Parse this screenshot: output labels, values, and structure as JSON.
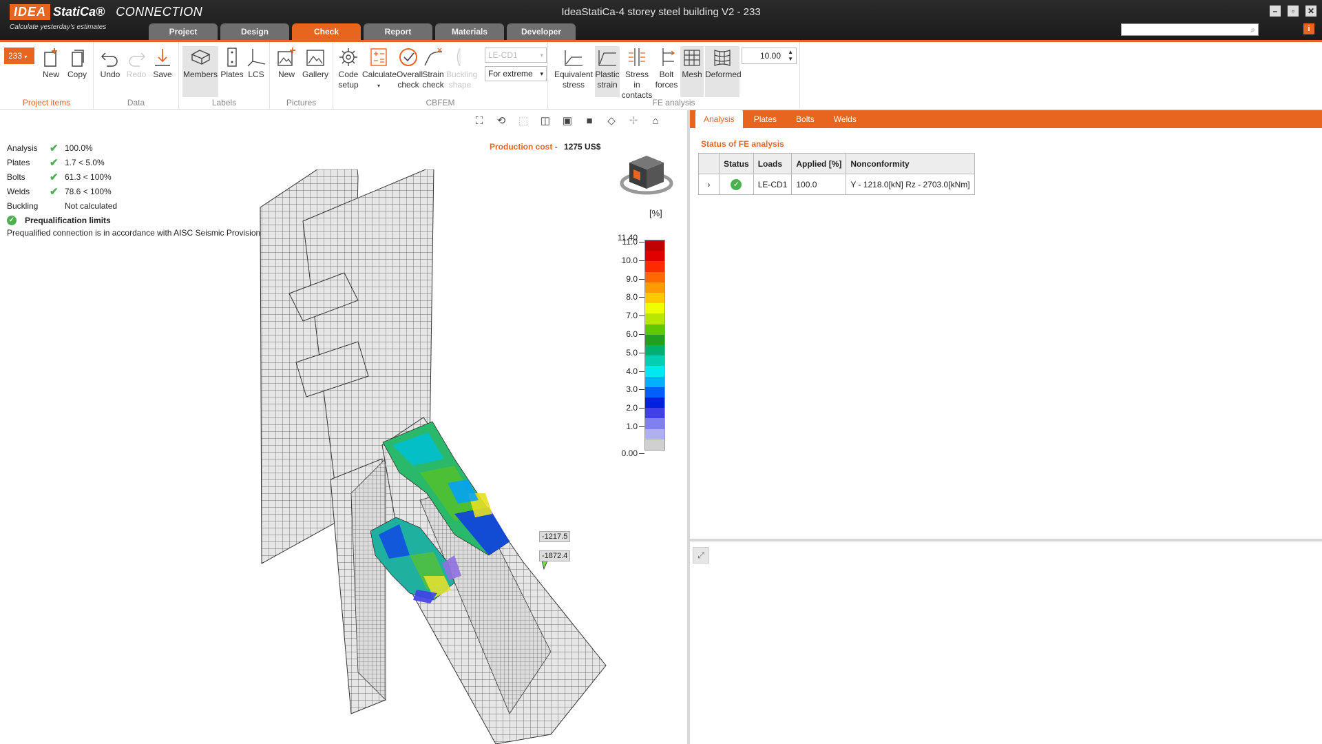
{
  "app": {
    "logo_brand": "IDEA",
    "logo_product": "StatiCa®",
    "logo_module": "CONNECTION",
    "tagline": "Calculate yesterday's estimates",
    "window_title": "IdeaStatiCa-4 storey steel building V2 - 233"
  },
  "main_tabs": [
    {
      "label": "Project",
      "active": false
    },
    {
      "label": "Design",
      "active": false
    },
    {
      "label": "Check",
      "active": true
    },
    {
      "label": "Report",
      "active": false
    },
    {
      "label": "Materials",
      "active": false
    },
    {
      "label": "Developer",
      "active": false
    }
  ],
  "ribbon": {
    "project_items": {
      "label": "Project items",
      "selected_item": "233",
      "new": "New",
      "copy": "Copy"
    },
    "data": {
      "label": "Data",
      "undo": "Undo",
      "redo": "Redo",
      "save": "Save"
    },
    "labels": {
      "label": "Labels",
      "members": "Members",
      "plates": "Plates",
      "lcs": "LCS"
    },
    "pictures": {
      "label": "Pictures",
      "new": "New",
      "gallery": "Gallery"
    },
    "cbfem": {
      "label": "CBFEM",
      "code_setup": "Code setup",
      "calculate": "Calculate",
      "overall_check": "Overall check",
      "strain_check": "Strain check",
      "buckling_shape": "Buckling shape",
      "load_case": "LE-CD1",
      "extreme_mode": "For extreme"
    },
    "fe_analysis": {
      "label": "FE analysis",
      "equivalent_stress": "Equivalent stress",
      "plastic_strain": "Plastic strain",
      "stress_in_contacts": "Stress in contacts",
      "bolt_forces": "Bolt forces",
      "mesh": "Mesh",
      "deformed": "Deformed",
      "deformation_scale": "10.00"
    }
  },
  "summary": {
    "rows": [
      {
        "label": "Analysis",
        "ok": true,
        "value": "100.0%"
      },
      {
        "label": "Plates",
        "ok": true,
        "value": "1.7 < 5.0%"
      },
      {
        "label": "Bolts",
        "ok": true,
        "value": "61.3 < 100%"
      },
      {
        "label": "Welds",
        "ok": true,
        "value": "78.6 < 100%"
      },
      {
        "label": "Buckling",
        "ok": false,
        "value": "Not calculated"
      }
    ],
    "prequalification_title": "Prequalification limits",
    "prequalification_text": "Prequalified connection is in accordance with AISC Seismic Provisions for Structural Steel Buildings"
  },
  "production_cost": {
    "label": "Production cost",
    "separator": "-",
    "value": "1275 US$"
  },
  "legend": {
    "unit": "[%]",
    "max": "11.40",
    "ticks": [
      "11.0",
      "10.0",
      "9.0",
      "8.0",
      "7.0",
      "6.0",
      "5.0",
      "4.0",
      "3.0",
      "2.0",
      "1.0",
      "0.00"
    ],
    "colors": [
      "#c00000",
      "#e00000",
      "#ff2a00",
      "#ff6a00",
      "#ff9a00",
      "#ffc800",
      "#f0ff00",
      "#b8e800",
      "#60c800",
      "#20a020",
      "#00b070",
      "#00d0b0",
      "#00e8f0",
      "#00b0ff",
      "#0060ff",
      "#0020e0",
      "#4040e8",
      "#8080f0",
      "#b0b0f0",
      "#d0d0d0"
    ]
  },
  "callouts": [
    "-1217.5",
    "-1872.4"
  ],
  "right_panel": {
    "tabs": [
      {
        "label": "Analysis",
        "active": true
      },
      {
        "label": "Plates",
        "active": false
      },
      {
        "label": "Bolts",
        "active": false
      },
      {
        "label": "Welds",
        "active": false
      }
    ],
    "status_title": "Status of FE analysis",
    "columns": [
      "Status",
      "Loads",
      "Applied [%]",
      "Nonconformity"
    ],
    "rows": [
      {
        "status": "ok",
        "loads": "LE-CD1",
        "applied": "100.0",
        "nonconformity": "Y - 1218.0[kN]  Rz - 2703.0[kNm]"
      }
    ]
  },
  "colors": {
    "accent": "#e8651f",
    "ok": "#4caf50"
  }
}
